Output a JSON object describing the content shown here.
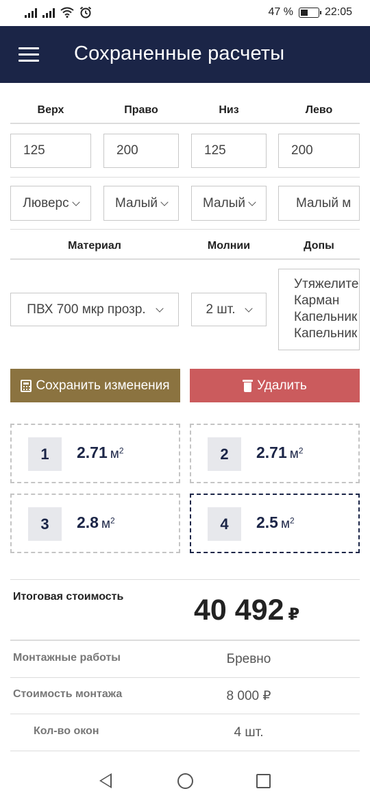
{
  "status": {
    "battery": "47 %",
    "time": "22:05"
  },
  "header": {
    "title": "Сохраненные расчеты"
  },
  "sides": {
    "labels": [
      "Верх",
      "Право",
      "Низ",
      "Лево"
    ],
    "values": [
      "125",
      "200",
      "125",
      "200"
    ],
    "fastenings": [
      "Люверс",
      "Малый",
      "Малый",
      "Малый м"
    ]
  },
  "options": {
    "material_label": "Материал",
    "zippers_label": "Молнии",
    "extras_label": "Допы",
    "material_value": "ПВХ 700 мкр прозр.",
    "zippers_value": "2 шт.",
    "extras": [
      "Утяжелите",
      "Карман",
      "Капельник",
      "Капельник"
    ]
  },
  "actions": {
    "save_label": "Сохранить изменения",
    "delete_label": "Удалить"
  },
  "windows": [
    {
      "num": "1",
      "area": "2.71",
      "unit": "м",
      "sup": "2",
      "active": false
    },
    {
      "num": "2",
      "area": "2.71",
      "unit": "м",
      "sup": "2",
      "active": false
    },
    {
      "num": "3",
      "area": "2.8",
      "unit": "м",
      "sup": "2",
      "active": false
    },
    {
      "num": "4",
      "area": "2.5",
      "unit": "м",
      "sup": "2",
      "active": true
    }
  ],
  "summary": {
    "total_label": "Итоговая стоимость",
    "total_value": "40 492",
    "currency": "₽",
    "rows": [
      {
        "label": "Монтажные работы",
        "value": "Бревно"
      },
      {
        "label": "Стоимость монтажа",
        "value": "8 000 ₽"
      },
      {
        "label": "Кол-во окон",
        "value": "4 шт."
      }
    ]
  }
}
